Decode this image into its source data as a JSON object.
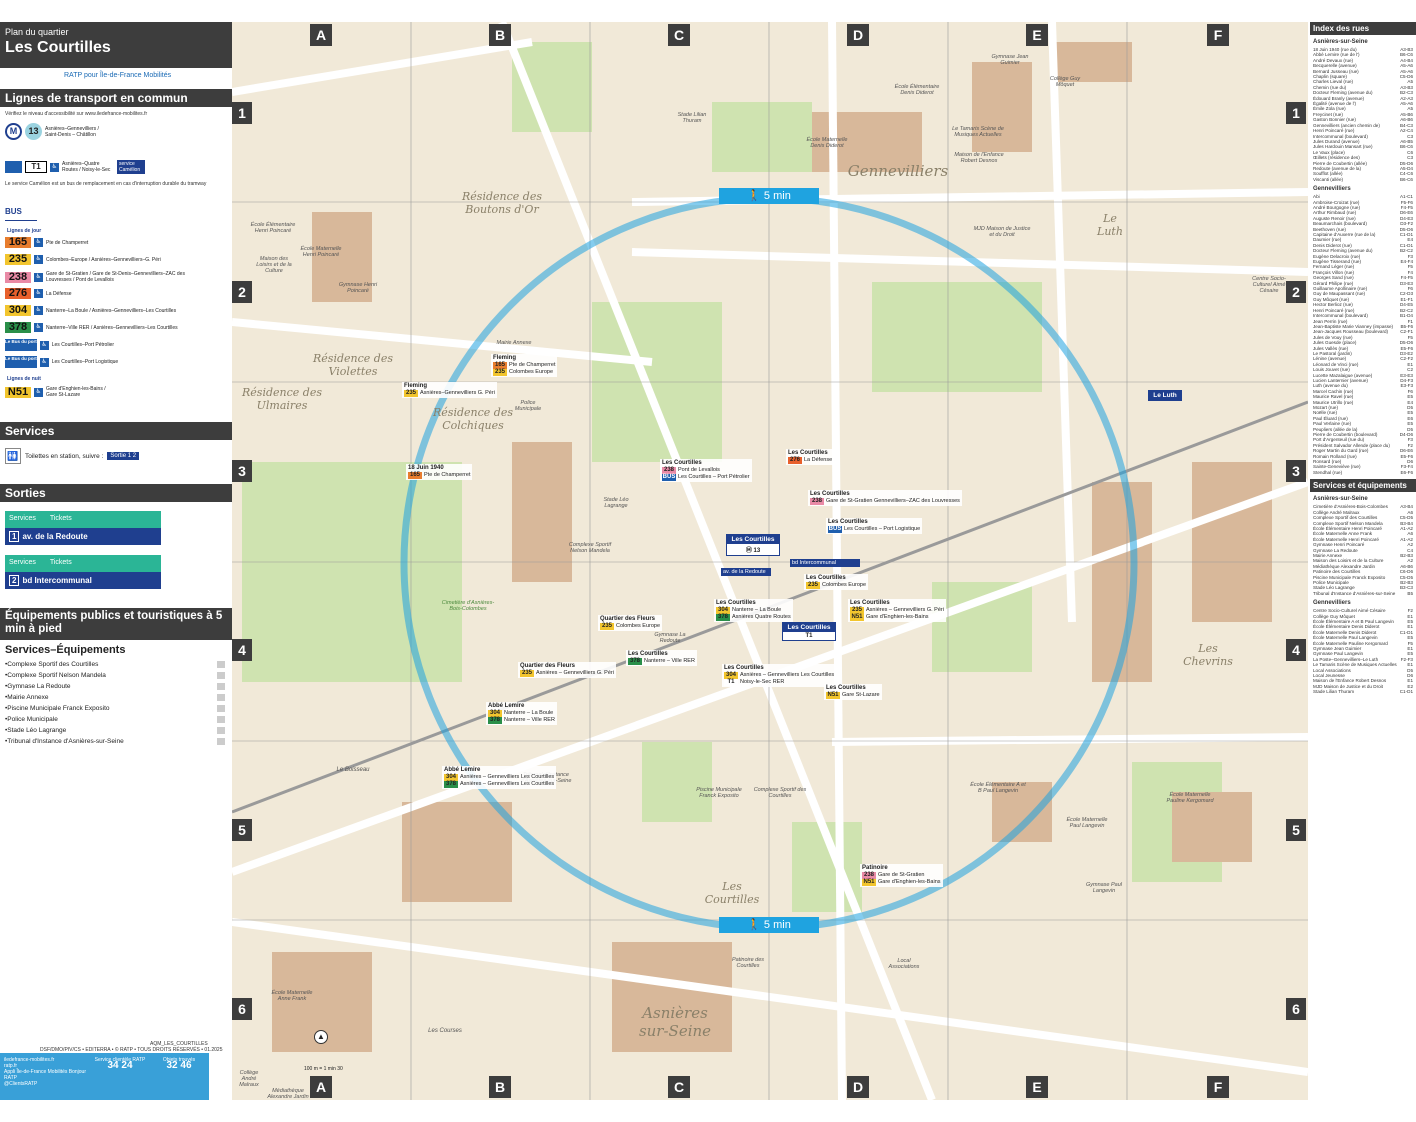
{
  "left": {
    "plan_sub": "Plan du quartier",
    "plan_title": "Les Courtilles",
    "logos": "RATP pour Île-de-France Mobilités",
    "lines_header": "Lignes de transport en commun",
    "accessibility_note": "Vérifiez le niveau d'accessibilité sur www.iledefrance-mobilites.fr",
    "metro": {
      "line": "13",
      "desc": "Asnières–Gennevilliers / Saint-Denis – Châtillon"
    },
    "tram": {
      "line": "T1",
      "desc": "Asnières–Quatre Routes / Noisy-le-Sec",
      "note": "Le service Camélion est un bus de remplacement en cas d'interruption durable du tramway",
      "camelion": "service Camélion"
    },
    "bus_label": "BUS",
    "day_lines_label": "Lignes de jour",
    "bus_lines": [
      {
        "num": "165",
        "color": "#e87d2d",
        "desc": "Pte de Champerret"
      },
      {
        "num": "235",
        "color": "#f2c52e",
        "desc": "Colombes–Europe / Asnières–Gennevilliers–G. Péri"
      },
      {
        "num": "238",
        "color": "#e98aa6",
        "desc": "Gare de St-Gratien / Gare de St-Denis–Gennevilliers–ZAC des Louvresses / Pont de Levallois"
      },
      {
        "num": "276",
        "color": "#e8602c",
        "desc": "La Défense"
      },
      {
        "num": "304",
        "color": "#f2c52e",
        "desc": "Nanterre–La Boule / Asnières–Gennevilliers–Les Courtilles"
      },
      {
        "num": "378",
        "color": "#2a8f49",
        "desc": "Nanterre–Ville RER / Asnières–Gennevilliers–Les Courtilles"
      },
      {
        "num": "Le Bus du port",
        "color": "#1f5fae",
        "desc": "Les Courtilles–Port Pétrolier"
      },
      {
        "num": "Le Bus du port",
        "color": "#1f5fae",
        "desc": "Les Courtilles–Port Logistique"
      }
    ],
    "night_lines_label": "Lignes de nuit",
    "night_line": {
      "num": "N51",
      "color": "#f2c52e",
      "desc": "Gare d'Enghien-les-Bains / Gare St-Lazare"
    },
    "services_header": "Services",
    "services_text": "Toilettes en station, suivre :",
    "services_exit": "Sortie",
    "sorties_header": "Sorties",
    "exits": [
      {
        "services": "Services",
        "tickets": "Tickets",
        "num": "1",
        "name": "av. de la Redoute"
      },
      {
        "services": "Services",
        "tickets": "Tickets",
        "num": "2",
        "name": "bd Intercommunal"
      }
    ],
    "equip_header": "Équipements publics et touristiques à 5 min à pied",
    "equip_sub": "Services–Équipements",
    "equip_items": [
      "•Complexe Sportif des Courtilles",
      "•Complexe Sportif Nelson Mandela",
      "•Gymnase La Redoute",
      "•Mairie Annexe",
      "•Piscine Municipale Franck Exposito",
      "•Police Municipale",
      "•Stade Léo Lagrange",
      "•Tribunal d'Instance d'Asnières-sur-Seine"
    ],
    "ref": "AQM_LES_COURTILLES",
    "copyright": "DSF/DMO/PIV/CS • EDITERRA • © RATP • TOUS DROITS RÉSERVÉS • 01.2025",
    "footer": {
      "web1": "iledefrance-mobilites.fr",
      "web2": "ratp.fr",
      "app": "Appli Île-de-France Mobilités Bonjour RATP",
      "twitter": "@ClientsRATP",
      "client_label": "Service clientèle RATP",
      "client_num": "34 24",
      "lost_label": "Objets trouvés",
      "lost_num": "32 46"
    }
  },
  "map": {
    "cols": [
      "A",
      "B",
      "C",
      "D",
      "E",
      "F"
    ],
    "rows": [
      "1",
      "2",
      "3",
      "4",
      "5",
      "6"
    ],
    "walk_label": "5 min",
    "places": [
      {
        "t": "Gennevilliers",
        "cls": "place-lg"
      },
      {
        "t": "Résidence des Boutons d'Or",
        "cls": "place-md"
      },
      {
        "t": "Résidence des Violettes",
        "cls": "place-md"
      },
      {
        "t": "Résidence des Ulmaires",
        "cls": "place-md"
      },
      {
        "t": "Résidence des Colchiques",
        "cls": "place-md"
      },
      {
        "t": "Le Luth",
        "cls": "place-md"
      },
      {
        "t": "Les Chevrins",
        "cls": "place-md"
      },
      {
        "t": "Les Courtilles",
        "cls": "place-md"
      },
      {
        "t": "Asnières sur-Seine",
        "cls": "place-lg"
      },
      {
        "t": "Le Boisseau",
        "cls": "place-sm"
      },
      {
        "t": "Les Courses",
        "cls": "place-sm"
      },
      {
        "t": "Cimetière d'Asnières-Bois-Colombes",
        "cls": "place-sm"
      }
    ],
    "pois": [
      "Stade Lilian Thuram",
      "École Élémentaire Denis Diderot",
      "École Maternelle Denis Diderot",
      "Le Tamaris Scène de Musiques Actuelles",
      "Maison de l'Enfance Robert Desnos",
      "Gymnase Jean Guimier",
      "Collège Guy Môquet",
      "MJD Maison de Justice et du Droit",
      "Centre Socio-Culturel Aimé Césaire",
      "École Élémentaire Henri Poincaré",
      "École Maternelle Henri Poincaré",
      "Maison des Loisirs et de la Culture",
      "Gymnase Henri Poincaré",
      "Mairie Annexe",
      "Police Municipale",
      "Stade Léo Lagrange",
      "Complexe Sportif Nelson Mandela",
      "Gymnase La Redoute",
      "Tribunal d'Instance d'Asnières-sur-Seine",
      "Piscine Municipale Franck Exposito",
      "Complexe Sportif des Courtilles",
      "Patinoire des Courtilles",
      "Local Associations",
      "École Élémentaire A et B Paul Langevin",
      "École Maternelle Paul Langevin",
      "Gymnase Paul Langevin",
      "École Maternelle Pauline Kergomard",
      "Collège André Malraux",
      "Médiathèque Alexandre Jardin",
      "École Maternelle Anne Frank"
    ],
    "stops": [
      {
        "name": "Fleming",
        "lines": [
          [
            "165",
            "Pte de Champerret"
          ],
          [
            "235",
            "Colombes Europe"
          ]
        ]
      },
      {
        "name": "Fleming",
        "lines": [
          [
            "235",
            "Asnières–Gennevilliers G. Péri"
          ]
        ]
      },
      {
        "name": "18 Juin 1940",
        "lines": [
          [
            "165",
            "Pte de Champerret"
          ]
        ]
      },
      {
        "name": "Les Courtilles",
        "lines": [
          [
            "238",
            "Pont de Levallois"
          ],
          [
            "BUS",
            "Les Courtilles – Port Pétrolier"
          ]
        ]
      },
      {
        "name": "Les Courtilles",
        "lines": [
          [
            "276",
            "La Défense"
          ]
        ]
      },
      {
        "name": "Les Courtilles",
        "lines": [
          [
            "238",
            "Gare de St-Gratien Gennevilliers–ZAC des Louvresses"
          ]
        ]
      },
      {
        "name": "Les Courtilles",
        "lines": [
          [
            "BUS",
            "Les Courtilles – Port Logistique"
          ]
        ]
      },
      {
        "name": "Les Courtilles",
        "lines": [
          [
            "235",
            "Colombes Europe"
          ]
        ]
      },
      {
        "name": "Les Courtilles",
        "lines": [
          [
            "304",
            "Nanterre – La Boule"
          ],
          [
            "378",
            "Asnières Quatre Routes"
          ]
        ]
      },
      {
        "name": "Les Courtilles",
        "lines": [
          [
            "235",
            "Asnières – Gennevilliers G. Péri"
          ],
          [
            "N51",
            "Gare d'Enghien-les-Bains"
          ]
        ]
      },
      {
        "name": "Les Courtilles",
        "lines": [
          [
            "304",
            "Asnières – Gennevilliers Les Courtilles"
          ],
          [
            "T1",
            "Noisy-le-Sec RER"
          ]
        ]
      },
      {
        "name": "Les Courtilles",
        "lines": [
          [
            "N51",
            "Gare St-Lazare"
          ]
        ]
      },
      {
        "name": "Quartier des Fleurs",
        "lines": [
          [
            "235",
            "Colombes Europe"
          ]
        ]
      },
      {
        "name": "Quartier des Fleurs",
        "lines": [
          [
            "235",
            "Asnières – Gennevilliers G. Péri"
          ]
        ]
      },
      {
        "name": "Les Courtilles",
        "lines": [
          [
            "378",
            "Nanterre – Ville RER"
          ]
        ]
      },
      {
        "name": "Abbé Lemire",
        "lines": [
          [
            "304",
            "Nanterre – La Boule"
          ],
          [
            "378",
            "Nanterre – Ville RER"
          ]
        ]
      },
      {
        "name": "Abbé Lemire",
        "lines": [
          [
            "304",
            "Asnières – Gennevilliers Les Courtilles"
          ],
          [
            "378",
            "Asnières – Gennevilliers Les Courtilles"
          ]
        ]
      },
      {
        "name": "Patinoire",
        "lines": [
          [
            "238",
            "Gare de St-Gratien"
          ],
          [
            "N51",
            "Gare d'Enghien-les-Bains"
          ]
        ]
      }
    ],
    "station_main": "Les Courtilles",
    "station_tram": "Les Courtilles",
    "station_luth": "Le Luth",
    "station_exit1": "av. de la Redoute",
    "station_exit2": "bd Intercommunal",
    "scale": "100 m = 1 min 30"
  },
  "right": {
    "index_header": "Index des rues",
    "asnieres": "Asnières-sur-Seine",
    "asnieres_streets": [
      [
        "18 Juin 1940 (rue du)",
        "A3-B3"
      ],
      [
        "Abbé Lemire (rue de l')",
        "B6-C6"
      ],
      [
        "André Devaux (rue)",
        "A4-B4"
      ],
      [
        "Becquerelle (avenue)",
        "A5-A6"
      ],
      [
        "Bernard Jusseau (rue)",
        "A5-A6"
      ],
      [
        "Chaplin (square)",
        "C5-D6"
      ],
      [
        "Charles Lieval (rue)",
        "A5"
      ],
      [
        "Chemin (rue du)",
        "A3-B3"
      ],
      [
        "Docteur Fleming (avenue du)",
        "B2-C3"
      ],
      [
        "Édouard Branly (avenue)",
        "A2-A3"
      ],
      [
        "Égalité (avenue de l')",
        "A5-A6"
      ],
      [
        "Émile Zola (rue)",
        "A5"
      ],
      [
        "Freycinet (rue)",
        "A5-B6"
      ],
      [
        "Gaston Bonnier (rue)",
        "A6-B6"
      ],
      [
        "Gennevilliers (ancien chemin de)",
        "B4-C3"
      ],
      [
        "Henri Poincaré (rue)",
        "A2-C4"
      ],
      [
        "Intercommunal (boulevard)",
        "C3"
      ],
      [
        "Jules Durand (avenue)",
        "A6-B5"
      ],
      [
        "Jules Hardouin Mansart (rue)",
        "B6-C6"
      ],
      [
        "Le Vaux (place)",
        "C6"
      ],
      [
        "Œillets (résidence des)",
        "C3"
      ],
      [
        "Pierre de Coubertin (allée)",
        "D5-D6"
      ],
      [
        "Redoute (avenue de la)",
        "A5-D4"
      ],
      [
        "Soufflot (allée)",
        "C4-C6"
      ],
      [
        "Viscanti (allée)",
        "B6-C6"
      ]
    ],
    "gennevilliers": "Gennevilliers",
    "gennevilliers_streets": [
      [
        "Abi",
        "A1-C1"
      ],
      [
        "Ambroise-Croizat (rue)",
        "F5-F6"
      ],
      [
        "André Bourgogne (rue)",
        "F4-F5"
      ],
      [
        "Arthur Rimbaud (rue)",
        "D6-E6"
      ],
      [
        "Auguste Renoir (rue)",
        "D4-E3"
      ],
      [
        "Beaumarchais (boulevard)",
        "D3-F2"
      ],
      [
        "Beethoven (rue)",
        "D5-D6"
      ],
      [
        "Capitaine d'Auxerre (rue de la)",
        "C1-D1"
      ],
      [
        "Daumier (rue)",
        "E4"
      ],
      [
        "Denis Diderot (rue)",
        "C1-D1"
      ],
      [
        "Docteur Fleming (avenue du)",
        "B2-C2"
      ],
      [
        "Eugène Delacroix (rue)",
        "F3"
      ],
      [
        "Eugène Tisserand (rue)",
        "E4-F4"
      ],
      [
        "Fernand Léger (rue)",
        "F5"
      ],
      [
        "François Villon (rue)",
        "F4"
      ],
      [
        "Georges Sand (rue)",
        "F4-F5"
      ],
      [
        "Gérard Philipe (rue)",
        "D3-E3"
      ],
      [
        "Guillaume Apollinaire (rue)",
        "F6"
      ],
      [
        "Guy de Maupassant (rue)",
        "C2-D3"
      ],
      [
        "Guy Môquet (rue)",
        "E1-F1"
      ],
      [
        "Hector Berlioz (rue)",
        "D4-E5"
      ],
      [
        "Henri Poincaré (rue)",
        "B2-C2"
      ],
      [
        "Intercommunal (boulevard)",
        "B1-D4"
      ],
      [
        "Jean Perrin (rue)",
        "F1"
      ],
      [
        "Jean-Baptiste Marie Vianney (impasse)",
        "B5-F6"
      ],
      [
        "Jean-Jacques Rousseau (boulevard)",
        "C2-F1"
      ],
      [
        "Jules de Vouy (rue)",
        "F5"
      ],
      [
        "Jules Guesde (place)",
        "D5-D6"
      ],
      [
        "Jules Vallès (rue)",
        "E5-F6"
      ],
      [
        "Le Pastoral (jardin)",
        "D3-E2"
      ],
      [
        "Lénine (avenue)",
        "C2-F2"
      ],
      [
        "Léonard de Vinci (rue)",
        "E1"
      ],
      [
        "Louis Jouvet (rue)",
        "C2"
      ],
      [
        "Lucette Mazalaigue (avenue)",
        "E3-E3"
      ],
      [
        "Lucien Lanternier (avenue)",
        "D4-F3"
      ],
      [
        "Luth (avenue du)",
        "E3-F3"
      ],
      [
        "Marcel Cachin (rue)",
        "F6"
      ],
      [
        "Maurice Ravel (rue)",
        "E5"
      ],
      [
        "Maurice Utrillo (rue)",
        "E4"
      ],
      [
        "Mozart (rue)",
        "D5"
      ],
      [
        "Noëlle (rue)",
        "E5"
      ],
      [
        "Paul Éluard (rue)",
        "E6"
      ],
      [
        "Paul Verlaine (rue)",
        "E5"
      ],
      [
        "Peupliers (allée de la)",
        "D5"
      ],
      [
        "Pierre de Coubertin (boulevard)",
        "D4-D6"
      ],
      [
        "Port d'Argenteuil (rue du)",
        "F3"
      ],
      [
        "Président Salvador Allende (place du)",
        "F2"
      ],
      [
        "Roger Martin du Gard (rue)",
        "D6-E6"
      ],
      [
        "Romain Rolland (rue)",
        "E5-F6"
      ],
      [
        "Ronsard (rue)",
        "D6"
      ],
      [
        "Sainte-Geneviève (rue)",
        "F3-F4"
      ],
      [
        "Stendhal (rue)",
        "E6-F6"
      ]
    ],
    "services_header": "Services et équipements",
    "svc_asnieres": "Asnières-sur-Seine",
    "svc_asnieres_items": [
      [
        "Cimetière d'Asnières-Bois-Colombes",
        "A3-B4"
      ],
      [
        "Collège André Malraux",
        "A6"
      ],
      [
        "Complexe Sportif des Courtilles",
        "C5-D5"
      ],
      [
        "Complexe Sportif Nelson Mandela",
        "B3-B4"
      ],
      [
        "École Élémentaire Henri Poincaré",
        "A1-A2"
      ],
      [
        "École Maternelle Anne Frank",
        "A6"
      ],
      [
        "École Maternelle Henri Poincaré",
        "A1-A2"
      ],
      [
        "Gymnase Henri Poincaré",
        "A2"
      ],
      [
        "Gymnase La Redoute",
        "C4"
      ],
      [
        "Mairie Annexe",
        "B2-B3"
      ],
      [
        "Maison des Loisirs et de la Culture",
        "A2"
      ],
      [
        "Médiathèque Alexandre Jardin",
        "A6-B6"
      ],
      [
        "Patinoire des Courtilles",
        "C6-D6"
      ],
      [
        "Piscine Municipale Franck Exposito",
        "C5-D5"
      ],
      [
        "Police Municipale",
        "B2-B3"
      ],
      [
        "Stade Léo Lagrange",
        "B3-C3"
      ],
      [
        "Tribunal d'Instance d'Asnières-sur-Seine",
        "B5"
      ]
    ],
    "svc_genne": "Gennevilliers",
    "svc_genne_items": [
      [
        "Centre Socio-Culturel Aimé Césaire",
        "F2"
      ],
      [
        "Collège Guy Môquet",
        "E1"
      ],
      [
        "École Élémentaire A et B Paul Langevin",
        "E5"
      ],
      [
        "École Élémentaire Denis Diderot",
        "E1"
      ],
      [
        "École Maternelle Denis Diderot",
        "C1-D1"
      ],
      [
        "École Maternelle Paul Langevin",
        "E5"
      ],
      [
        "École Maternelle Pauline Kergomard",
        "F5"
      ],
      [
        "Gymnase Jean Guimier",
        "E1"
      ],
      [
        "Gymnase Paul Langevin",
        "E5"
      ],
      [
        "La Poste–Gennevilliers–Le Luth",
        "F2-F3"
      ],
      [
        "Le Tamaris Scène de Musiques Actuelles",
        "E1"
      ],
      [
        "Local Associations",
        "D5"
      ],
      [
        "Local Jeunesse",
        "D6"
      ],
      [
        "Maison de l'Enfance Robert Desnos",
        "E1"
      ],
      [
        "MJD Maison de Justice et du Droit",
        "E2"
      ],
      [
        "Stade Lilian Thuram",
        "C1-D1"
      ]
    ]
  }
}
